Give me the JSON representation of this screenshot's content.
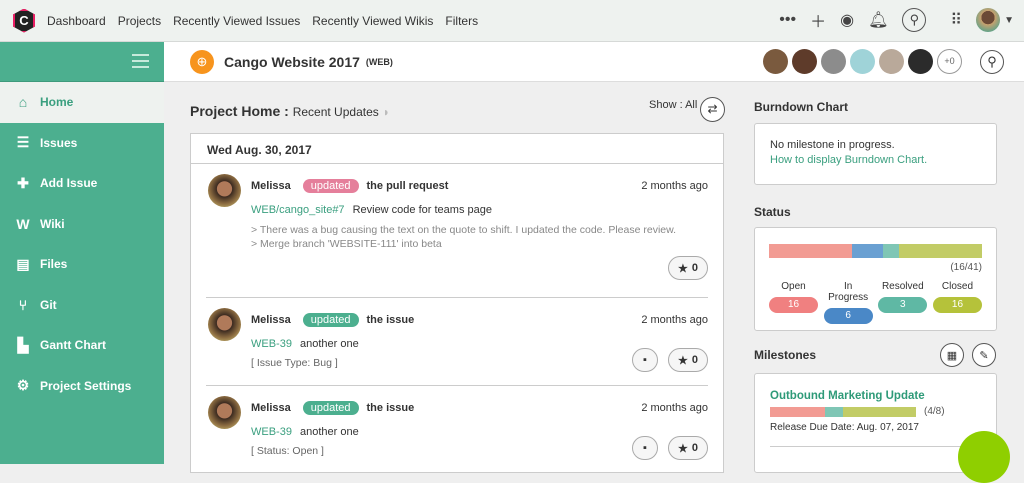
{
  "topnav": {
    "logo": "C",
    "items": [
      "Dashboard",
      "Projects",
      "Recently Viewed Issues",
      "Recently Viewed Wikis",
      "Filters"
    ]
  },
  "project": {
    "title": "Cango Website 2017",
    "key": "(WEB)",
    "extra_members": "+0"
  },
  "sidebar": {
    "items": [
      {
        "label": "Home",
        "icon": "home-icon"
      },
      {
        "label": "Issues",
        "icon": "list-icon"
      },
      {
        "label": "Add Issue",
        "icon": "plus-icon"
      },
      {
        "label": "Wiki",
        "icon": "wiki-icon"
      },
      {
        "label": "Files",
        "icon": "folder-icon"
      },
      {
        "label": "Git",
        "icon": "git-icon"
      },
      {
        "label": "Gantt Chart",
        "icon": "gantt-icon"
      },
      {
        "label": "Project Settings",
        "icon": "gear-icon"
      }
    ]
  },
  "main": {
    "title": "Project Home",
    "subtitle": "Recent Updates",
    "show": "Show : All",
    "date": "Wed Aug. 30, 2017",
    "items": [
      {
        "user": "Melissa",
        "action": "updated",
        "action_color": "#e57f9b",
        "text": "the pull request",
        "ago": "2 months ago",
        "link": "WEB/cango_site#7",
        "summary": "Review code for teams page",
        "details": [
          "> There was a bug causing the text on the quote to shift. I updated the code. Please review.",
          "> Merge branch 'WEBSITE-111' into beta"
        ],
        "stars": "0"
      },
      {
        "user": "Melissa",
        "action": "updated",
        "action_color": "#4caf8f",
        "text": "the issue",
        "ago": "2 months ago",
        "link": "WEB-39",
        "summary": "another one",
        "details": [
          "[ Issue Type: Bug ]"
        ],
        "stars": "0"
      },
      {
        "user": "Melissa",
        "action": "updated",
        "action_color": "#4caf8f",
        "text": "the issue",
        "ago": "2 months ago",
        "link": "WEB-39",
        "summary": "another one",
        "details": [
          "[ Status: Open ]"
        ],
        "stars": "0"
      }
    ]
  },
  "burndown": {
    "title": "Burndown Chart",
    "message": "No milestone in progress.",
    "link": "How to display Burndown Chart."
  },
  "status": {
    "title": "Status",
    "ratio": "(16/41)",
    "counts": [
      {
        "label": "Open",
        "value": "16",
        "color": "#f08080"
      },
      {
        "label": "In Progress",
        "value": "6",
        "color": "#4a88c7"
      },
      {
        "label": "Resolved",
        "value": "3",
        "color": "#5fb8a4"
      },
      {
        "label": "Closed",
        "value": "16",
        "color": "#b5c23a"
      }
    ]
  },
  "milestones": {
    "title": "Milestones",
    "items": [
      {
        "name": "Outbound Marketing Update",
        "ratio": "(4/8)",
        "due": "Release Due Date: Aug. 07, 2017",
        "segments": [
          3,
          1,
          4
        ]
      }
    ]
  }
}
